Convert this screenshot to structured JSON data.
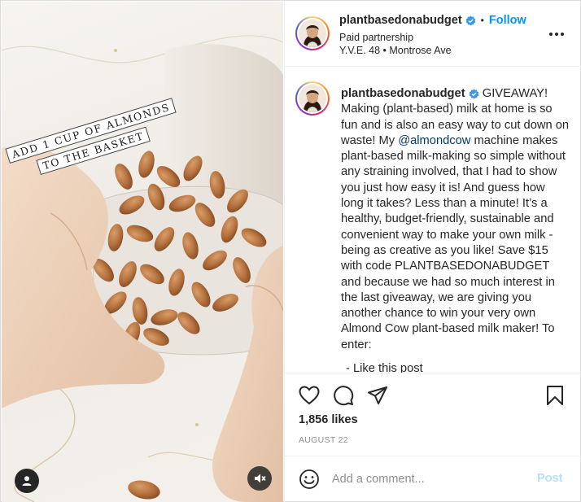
{
  "media": {
    "overlay_line1": "ADD 1 CUP OF ALMONDS",
    "overlay_line2": "TO THE BASKET",
    "user_tag_icon": "user-icon",
    "mute_icon": "speaker-muted-icon"
  },
  "header": {
    "username": "plantbasedonabudget",
    "verified_icon": "verified-badge-icon",
    "separator": "•",
    "follow_label": "Follow",
    "paid_partnership": "Paid partnership",
    "location": "Y.V.E. 48 • Montrose Ave",
    "more_icon": "more-options-icon"
  },
  "caption": {
    "username": "plantbasedonabudget",
    "text_before_mention": "GIVEAWAY! Making (plant-based) milk at home is so fun and is also an easy way to cut down on waste! My ",
    "mention": "@almondcow",
    "text_after_mention": " machine makes plant-based milk-making so simple without any straining involved, that I had to show you just how easy it is! And guess how long it takes? Less than a minute! It’s a healthy, budget-friendly, sustainable and convenient way to make your own milk - being as creative as you like! Save $15 with code PLANTBASEDONABUDGET and because we had so much interest in the last giveaway, we are giving you another chance to win your very own Almond Cow plant-based milk maker! To enter:",
    "next_line_partial": "- Like this post"
  },
  "actions": {
    "like_icon": "heart-icon",
    "comment_icon": "comment-bubble-icon",
    "share_icon": "paper-plane-icon",
    "save_icon": "bookmark-icon"
  },
  "likes": "1,856 likes",
  "date": "AUGUST 22",
  "comment_box": {
    "emoji_icon": "smiley-icon",
    "placeholder": "Add a comment...",
    "post_label": "Post"
  },
  "colors": {
    "link_blue": "#0095f6",
    "mention_blue": "#00376b",
    "post_disabled": "#b2dffc",
    "muted_text": "#8e8e8e"
  }
}
